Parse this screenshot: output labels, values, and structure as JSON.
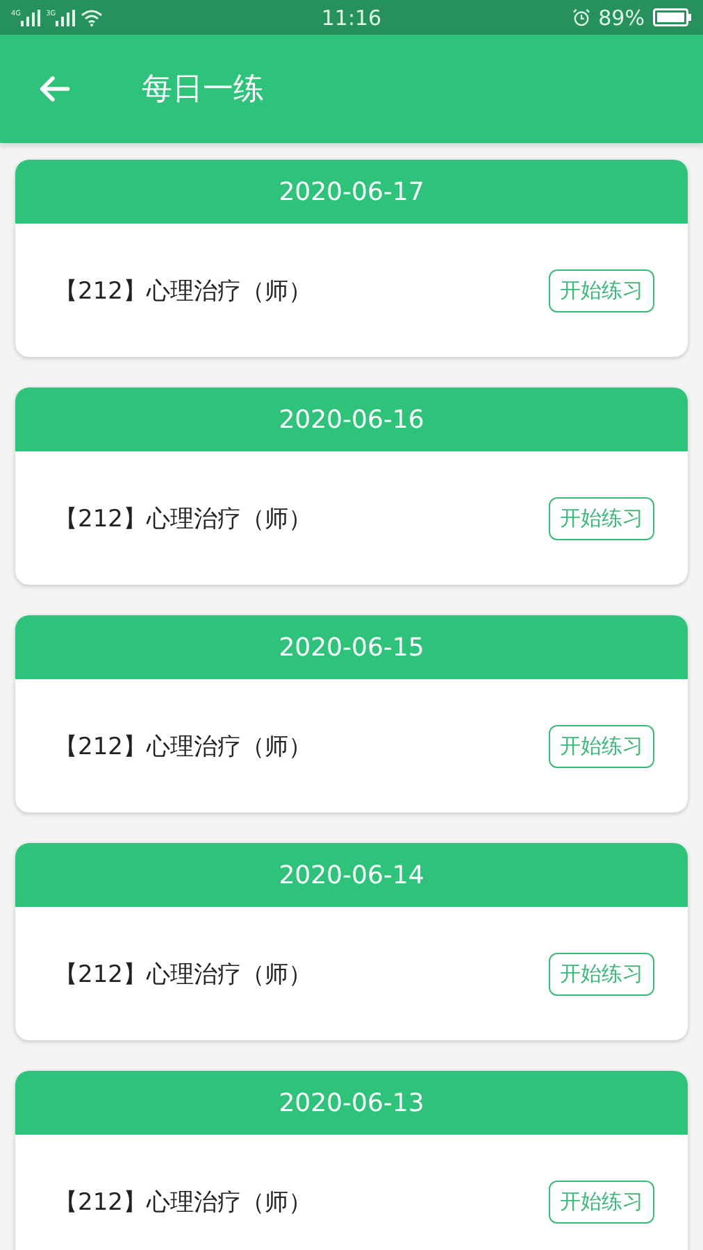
{
  "status_bar": {
    "networks": [
      "4G",
      "3G"
    ],
    "time": "11:16",
    "battery": "89%"
  },
  "header": {
    "title": "每日一练"
  },
  "cards": [
    {
      "date": "2020-06-17",
      "subject": "【212】心理治疗（师）",
      "button": "开始练习"
    },
    {
      "date": "2020-06-16",
      "subject": "【212】心理治疗（师）",
      "button": "开始练习"
    },
    {
      "date": "2020-06-15",
      "subject": "【212】心理治疗（师）",
      "button": "开始练习"
    },
    {
      "date": "2020-06-14",
      "subject": "【212】心理治疗（师）",
      "button": "开始练习"
    },
    {
      "date": "2020-06-13",
      "subject": "【212】心理治疗（师）",
      "button": "开始练习"
    }
  ]
}
